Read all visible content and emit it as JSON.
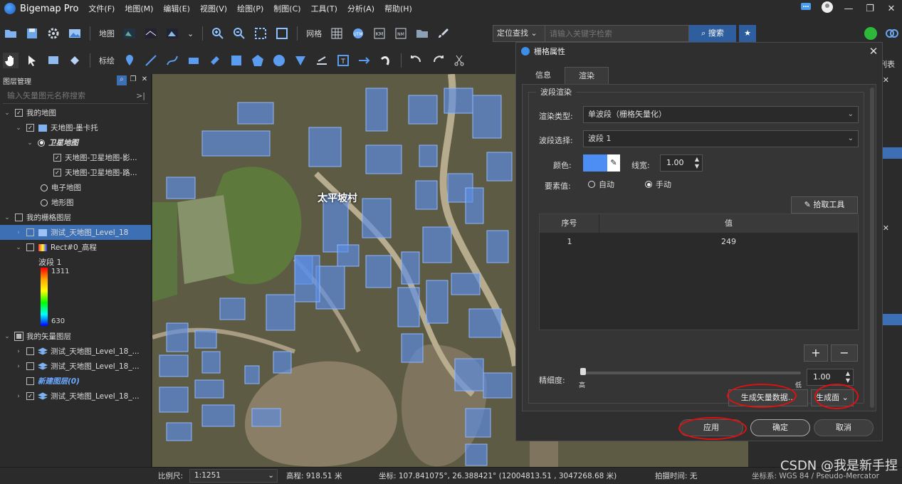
{
  "app": {
    "name": "Bigemap Pro",
    "menu": [
      "文件(F)",
      "地图(M)",
      "编辑(E)",
      "视图(V)",
      "绘图(P)",
      "制图(C)",
      "工具(T)",
      "分析(A)",
      "帮助(H)"
    ]
  },
  "toolbar1": {
    "map_label": "地图",
    "grid_label": "网格",
    "locate_mode": "定位查找",
    "search_placeholder": "请输入关键字检索",
    "search_button": "搜索"
  },
  "toolbar2": {
    "mark_label": "标绘"
  },
  "layer_panel": {
    "title": "图层管理",
    "search_placeholder": "输入矢量图元名称搜索",
    "tree": [
      {
        "label": "我的地图"
      },
      {
        "label": "天地图-墨卡托"
      },
      {
        "label": "卫星地图"
      },
      {
        "label": "天地图-卫星地图-影..."
      },
      {
        "label": "天地图-卫星地图-路..."
      },
      {
        "label": "电子地图"
      },
      {
        "label": "地形图"
      },
      {
        "label": "我的栅格图层"
      },
      {
        "label": "测试_天地图_Level_18"
      },
      {
        "label": "Rect#0_高程"
      },
      {
        "label": "我的矢量图层"
      },
      {
        "label": "测试_天地图_Level_18_..."
      },
      {
        "label": "测试_天地图_Level_18_..."
      },
      {
        "label": "新建图层(0)"
      },
      {
        "label": "测试_天地图_Level_18_..."
      }
    ],
    "legend": {
      "band": "波段 1",
      "max": "1311",
      "min": "630"
    }
  },
  "map": {
    "place_label": "太平坡村"
  },
  "dialog": {
    "title": "栅格属性",
    "tabs": [
      "信息",
      "渲染"
    ],
    "active_tab": "渲染",
    "group_title": "波段渲染",
    "render_type_label": "渲染类型:",
    "render_type_value": "单波段（栅格矢量化）",
    "band_label": "波段选择:",
    "band_value": "波段 1",
    "color_label": "颜色:",
    "color_value": "#4d8ef5",
    "linewidth_label": "线宽:",
    "linewidth_value": "1.00",
    "feature_label": "要素值:",
    "feature_auto": "自动",
    "feature_manual": "手动",
    "feature_selected": "手动",
    "pick_tool": "拾取工具",
    "table_headers": [
      "序号",
      "值"
    ],
    "table_rows": [
      {
        "index": "1",
        "value": "249"
      }
    ],
    "add": "+",
    "remove": "−",
    "precision_label": "精细度:",
    "precision_high": "高",
    "precision_low": "低",
    "precision_value": "1.00",
    "gen_vector": "生成矢量数据...",
    "gen_type": "生成面",
    "apply": "应用",
    "ok": "确定",
    "cancel": "取消"
  },
  "right_panel": {
    "partial_label": "列表"
  },
  "status": {
    "scale_label": "比例尺:",
    "scale_value": "1:1251",
    "elevation": "高程: 918.51 米",
    "coords": "坐标: 107.841075°, 26.388421°  (12004813.51 , 3047268.68 米)",
    "capture_time": "拍摄时间: 无",
    "crs": "坐标系: WGS 84 / Pseudo-Mercator"
  },
  "watermark": "CSDN @我是新手捏",
  "colors": {
    "accent": "#3d6fb4",
    "annotation": "#e01010",
    "buildings": "#5b8ee6"
  }
}
